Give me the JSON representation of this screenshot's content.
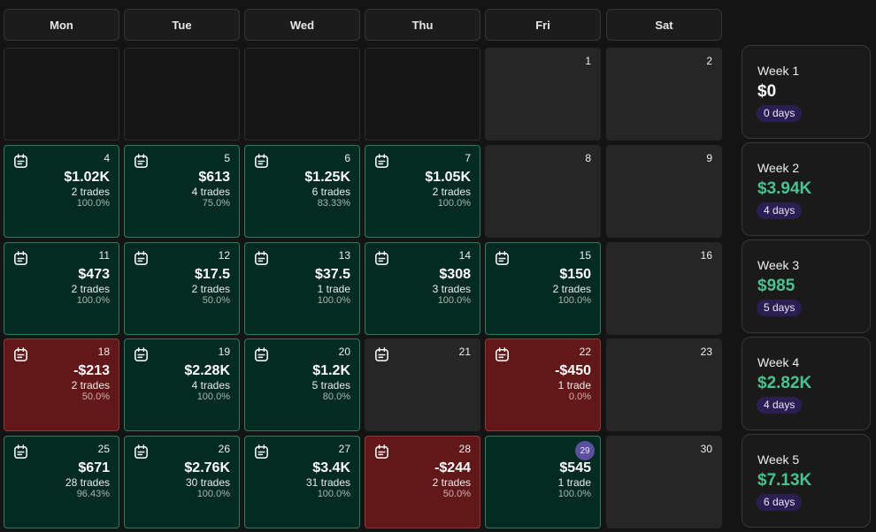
{
  "header": {
    "days": [
      "Mon",
      "Tue",
      "Wed",
      "Thu",
      "Fri",
      "Sat"
    ]
  },
  "icons": {
    "journal_note": "journal-note-icon"
  },
  "colors": {
    "profit_bg": "#032b21",
    "profit_border": "#2d7c5f",
    "loss_bg": "#621818",
    "week_positive": "#4bc192",
    "days_badge": "#2b1f52",
    "today_circle": "#5c4f9e"
  },
  "cells": [
    {
      "day": "",
      "state": "empty"
    },
    {
      "day": "",
      "state": "empty"
    },
    {
      "day": "",
      "state": "empty"
    },
    {
      "day": "",
      "state": "empty"
    },
    {
      "day": "1",
      "state": "noday"
    },
    {
      "day": "2",
      "state": "noday"
    },
    {
      "day": "4",
      "state": "green",
      "note": true,
      "pnl": "$1.02K",
      "trades": "2 trades",
      "winrate": "100.0%"
    },
    {
      "day": "5",
      "state": "green",
      "note": true,
      "pnl": "$613",
      "trades": "4 trades",
      "winrate": "75.0%"
    },
    {
      "day": "6",
      "state": "green",
      "note": true,
      "pnl": "$1.25K",
      "trades": "6 trades",
      "winrate": "83.33%"
    },
    {
      "day": "7",
      "state": "green",
      "note": true,
      "pnl": "$1.05K",
      "trades": "2 trades",
      "winrate": "100.0%"
    },
    {
      "day": "8",
      "state": "noday"
    },
    {
      "day": "9",
      "state": "noday"
    },
    {
      "day": "11",
      "state": "green",
      "note": true,
      "pnl": "$473",
      "trades": "2 trades",
      "winrate": "100.0%"
    },
    {
      "day": "12",
      "state": "green",
      "note": true,
      "pnl": "$17.5",
      "trades": "2 trades",
      "winrate": "50.0%"
    },
    {
      "day": "13",
      "state": "green",
      "note": true,
      "pnl": "$37.5",
      "trades": "1 trade",
      "winrate": "100.0%"
    },
    {
      "day": "14",
      "state": "green",
      "note": true,
      "pnl": "$308",
      "trades": "3 trades",
      "winrate": "100.0%"
    },
    {
      "day": "15",
      "state": "green",
      "note": true,
      "pnl": "$150",
      "trades": "2 trades",
      "winrate": "100.0%"
    },
    {
      "day": "16",
      "state": "noday"
    },
    {
      "day": "18",
      "state": "red",
      "note": true,
      "pnl": "-$213",
      "trades": "2 trades",
      "winrate": "50.0%"
    },
    {
      "day": "19",
      "state": "green",
      "note": true,
      "pnl": "$2.28K",
      "trades": "4 trades",
      "winrate": "100.0%"
    },
    {
      "day": "20",
      "state": "green",
      "note": true,
      "pnl": "$1.2K",
      "trades": "5 trades",
      "winrate": "80.0%"
    },
    {
      "day": "21",
      "state": "noday",
      "note": true
    },
    {
      "day": "22",
      "state": "red",
      "note": true,
      "pnl": "-$450",
      "trades": "1 trade",
      "winrate": "0.0%"
    },
    {
      "day": "23",
      "state": "noday"
    },
    {
      "day": "25",
      "state": "green",
      "note": true,
      "pnl": "$671",
      "trades": "28 trades",
      "winrate": "96.43%"
    },
    {
      "day": "26",
      "state": "green",
      "note": true,
      "pnl": "$2.76K",
      "trades": "30 trades",
      "winrate": "100.0%"
    },
    {
      "day": "27",
      "state": "green",
      "note": true,
      "pnl": "$3.4K",
      "trades": "31 trades",
      "winrate": "100.0%"
    },
    {
      "day": "28",
      "state": "red",
      "note": true,
      "pnl": "-$244",
      "trades": "2 trades",
      "winrate": "50.0%"
    },
    {
      "day": "29",
      "state": "green",
      "today": true,
      "pnl": "$545",
      "trades": "1 trade",
      "winrate": "100.0%"
    },
    {
      "day": "30",
      "state": "noday"
    }
  ],
  "weeks": [
    {
      "label": "Week 1",
      "total": "$0",
      "days": "0 days",
      "positive": false
    },
    {
      "label": "Week 2",
      "total": "$3.94K",
      "days": "4 days",
      "positive": true
    },
    {
      "label": "Week 3",
      "total": "$985",
      "days": "5 days",
      "positive": true
    },
    {
      "label": "Week 4",
      "total": "$2.82K",
      "days": "4 days",
      "positive": true
    },
    {
      "label": "Week 5",
      "total": "$7.13K",
      "days": "6 days",
      "positive": true
    }
  ]
}
